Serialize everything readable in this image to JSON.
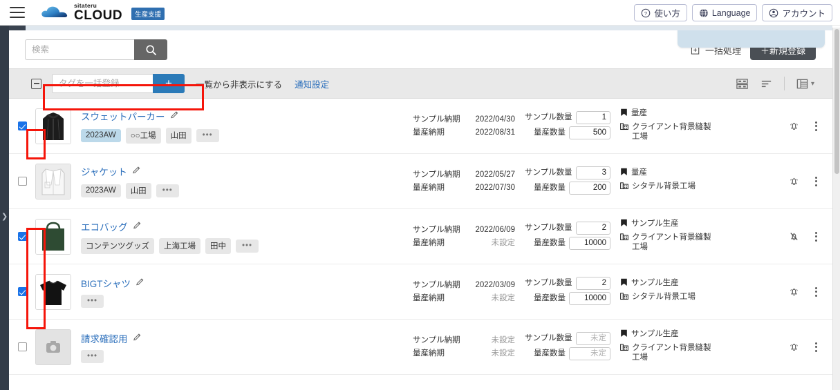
{
  "header": {
    "menu_icon": "hamburger-icon",
    "logo_small": "sitateru",
    "logo_main": "CLOUD",
    "logo_badge": "生産支援",
    "buttons": [
      {
        "label": "使い方",
        "icon": "help-circle-icon"
      },
      {
        "label": "Language",
        "icon": "globe-icon"
      },
      {
        "label": "アカウント",
        "icon": "account-circle-icon"
      }
    ]
  },
  "sidebar": {
    "expand_icon": "chevron-right-icon"
  },
  "search": {
    "placeholder": "検索",
    "value": "",
    "button_icon": "search-icon"
  },
  "actions": {
    "bulk_label": "一括処理",
    "bulk_icon": "bulk-process-icon",
    "new_label": "＋新規登録"
  },
  "toolbar": {
    "select_all_icon": "indeterminate-checkbox-icon",
    "tag_placeholder": "タグを一括登録",
    "tag_value": "",
    "tag_add_label": "+",
    "hide_link": "一覧から非表示にする",
    "notify_link": "通知設定",
    "icons": [
      "layout-grid-icon",
      "sort-icon",
      "table-view-icon",
      "chevron-down-icon"
    ]
  },
  "columns": {
    "sample_due": "サンプル納期",
    "mass_due": "量産納期",
    "sample_qty": "サンプル数量",
    "mass_qty": "量産数量"
  },
  "rows": [
    {
      "checked": true,
      "title": "スウェットパーカー",
      "edit_icon": "pencil-icon",
      "thumb": "hoodie-photo",
      "tags": [
        "2023AW",
        "○○工場",
        "山田"
      ],
      "tag_accent": "2023AW",
      "more_tag": "•••",
      "sample_due": "2022/04/30",
      "mass_due": "2022/08/31",
      "sample_due_unset": false,
      "mass_due_unset": false,
      "sample_qty": "1",
      "mass_qty": "500",
      "qty_unset": false,
      "status": "量産",
      "factory": "クライアント背景縫製工場",
      "bell": "bell-icon",
      "menu": "kebab-menu-icon"
    },
    {
      "checked": false,
      "title": "ジャケット",
      "edit_icon": "pencil-icon",
      "thumb": "jacket-photo",
      "tags": [
        "2023AW",
        "山田"
      ],
      "tag_accent": "",
      "more_tag": "•••",
      "sample_due": "2022/05/27",
      "mass_due": "2022/07/30",
      "sample_due_unset": false,
      "mass_due_unset": false,
      "sample_qty": "3",
      "mass_qty": "200",
      "qty_unset": false,
      "status": "量産",
      "factory": "シタテル背景工場",
      "bell": "bell-icon",
      "menu": "kebab-menu-icon"
    },
    {
      "checked": true,
      "title": "エコバッグ",
      "edit_icon": "pencil-icon",
      "thumb": "ecobag-photo",
      "tags": [
        "コンテンツグッズ",
        "上海工場",
        "田中"
      ],
      "tag_accent": "",
      "more_tag": "•••",
      "sample_due": "2022/06/09",
      "mass_due": "未設定",
      "sample_due_unset": false,
      "mass_due_unset": true,
      "sample_qty": "2",
      "mass_qty": "10000",
      "qty_unset": false,
      "status": "サンプル生産",
      "factory": "クライアント背景縫製工場",
      "bell": "bell-off-icon",
      "menu": "kebab-menu-icon"
    },
    {
      "checked": true,
      "title": "BIGTシャツ",
      "edit_icon": "pencil-icon",
      "thumb": "tshirt-photo",
      "tags": [],
      "tag_accent": "",
      "more_tag": "•••",
      "sample_due": "2022/03/09",
      "mass_due": "未設定",
      "sample_due_unset": false,
      "mass_due_unset": true,
      "sample_qty": "2",
      "mass_qty": "10000",
      "qty_unset": false,
      "status": "サンプル生産",
      "factory": "シタテル背景工場",
      "bell": "bell-icon",
      "menu": "kebab-menu-icon"
    },
    {
      "checked": false,
      "title": "請求確認用",
      "edit_icon": "pencil-icon",
      "thumb": "camera-placeholder-icon",
      "tags": [],
      "tag_accent": "",
      "more_tag": "•••",
      "sample_due": "未設定",
      "mass_due": "未設定",
      "sample_due_unset": true,
      "mass_due_unset": true,
      "sample_qty": "未定",
      "mass_qty": "未定",
      "qty_unset": true,
      "status": "サンプル生産",
      "factory": "クライアント背景縫製工場",
      "bell": "bell-icon",
      "menu": "kebab-menu-icon"
    }
  ],
  "annotations": {
    "color": "#f5150a",
    "boxes": [
      "tag-bulk-register-input",
      "row-1-checkbox",
      "row-3-and-4-checkboxes"
    ]
  }
}
